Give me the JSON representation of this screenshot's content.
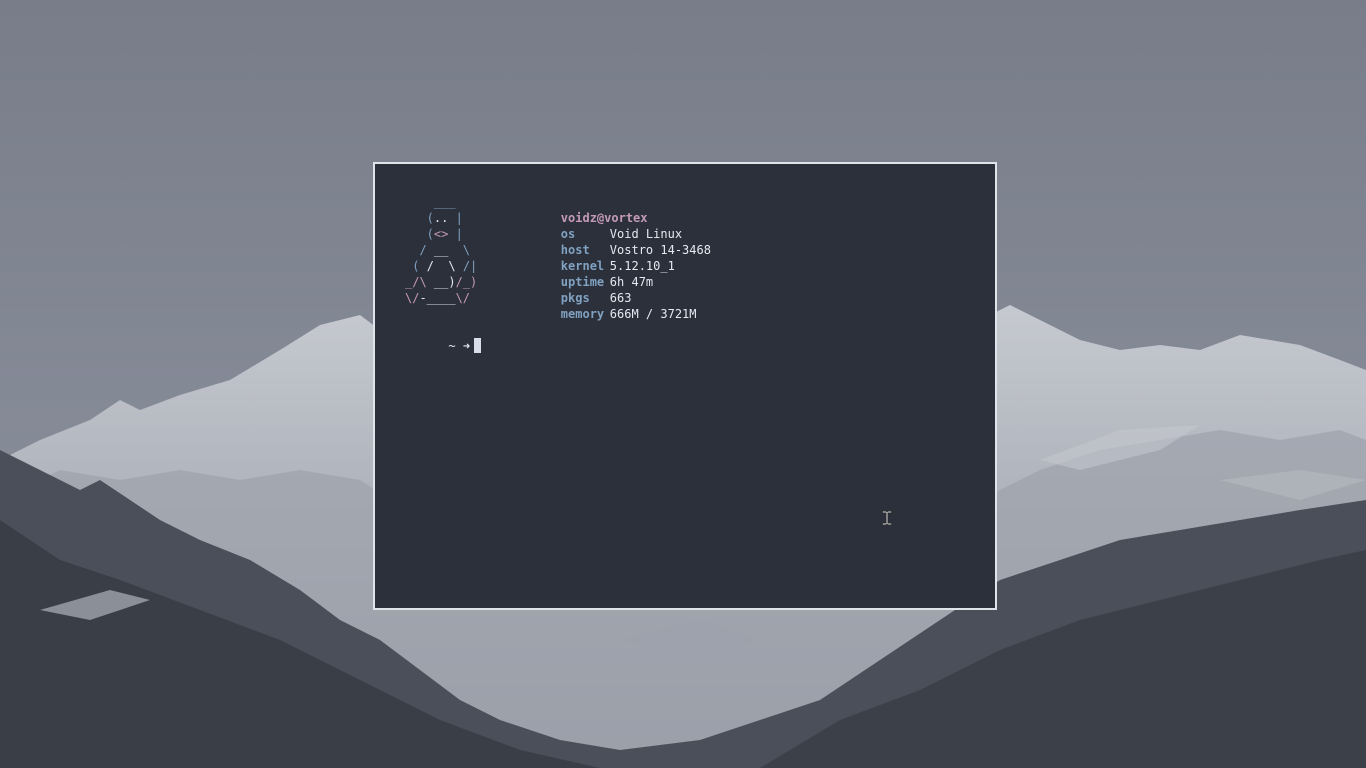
{
  "desktop": {
    "wallpaper_icon": "mountain-landscape-wallpaper"
  },
  "terminal": {
    "colors": {
      "background": "#2b303b",
      "border": "#dfe3ea",
      "accent_blue": "#81a1c1",
      "accent_pink": "#c49ab8",
      "text": "#e5e9f0"
    },
    "logo_lines": [
      [
        {
          "t": "    ___",
          "c": "blue"
        }
      ],
      [
        {
          "t": "   (",
          "c": "blue"
        },
        {
          "t": "..",
          "c": "white"
        },
        {
          "t": " |",
          "c": "blue"
        }
      ],
      [
        {
          "t": "   (",
          "c": "blue"
        },
        {
          "t": "<>",
          "c": "pink"
        },
        {
          "t": " |",
          "c": "blue"
        }
      ],
      [
        {
          "t": "  / ",
          "c": "blue"
        },
        {
          "t": "__",
          "c": "white"
        },
        {
          "t": "  \\",
          "c": "blue"
        }
      ],
      [
        {
          "t": " ( ",
          "c": "blue"
        },
        {
          "t": "/  \\",
          "c": "white"
        },
        {
          "t": " /|",
          "c": "blue"
        }
      ],
      [
        {
          "t": "_/\\",
          "c": "pink"
        },
        {
          "t": " __)",
          "c": "white"
        },
        {
          "t": "/_)",
          "c": "pink"
        }
      ],
      [
        {
          "t": "\\/",
          "c": "pink"
        },
        {
          "t": "-____",
          "c": "white"
        },
        {
          "t": "\\/",
          "c": "pink"
        }
      ]
    ],
    "user_host": "voidz@vortex",
    "info": [
      {
        "key": "os",
        "value": "Void Linux"
      },
      {
        "key": "host",
        "value": "Vostro 14-3468"
      },
      {
        "key": "kernel",
        "value": "5.12.10_1"
      },
      {
        "key": "uptime",
        "value": "6h 47m"
      },
      {
        "key": "pkgs",
        "value": "663"
      },
      {
        "key": "memory",
        "value": "666M / 3721M"
      }
    ],
    "prompt": {
      "dir": "~",
      "arrow": "➜"
    }
  },
  "mouse": {
    "icon": "text-ibeam-cursor-icon"
  }
}
